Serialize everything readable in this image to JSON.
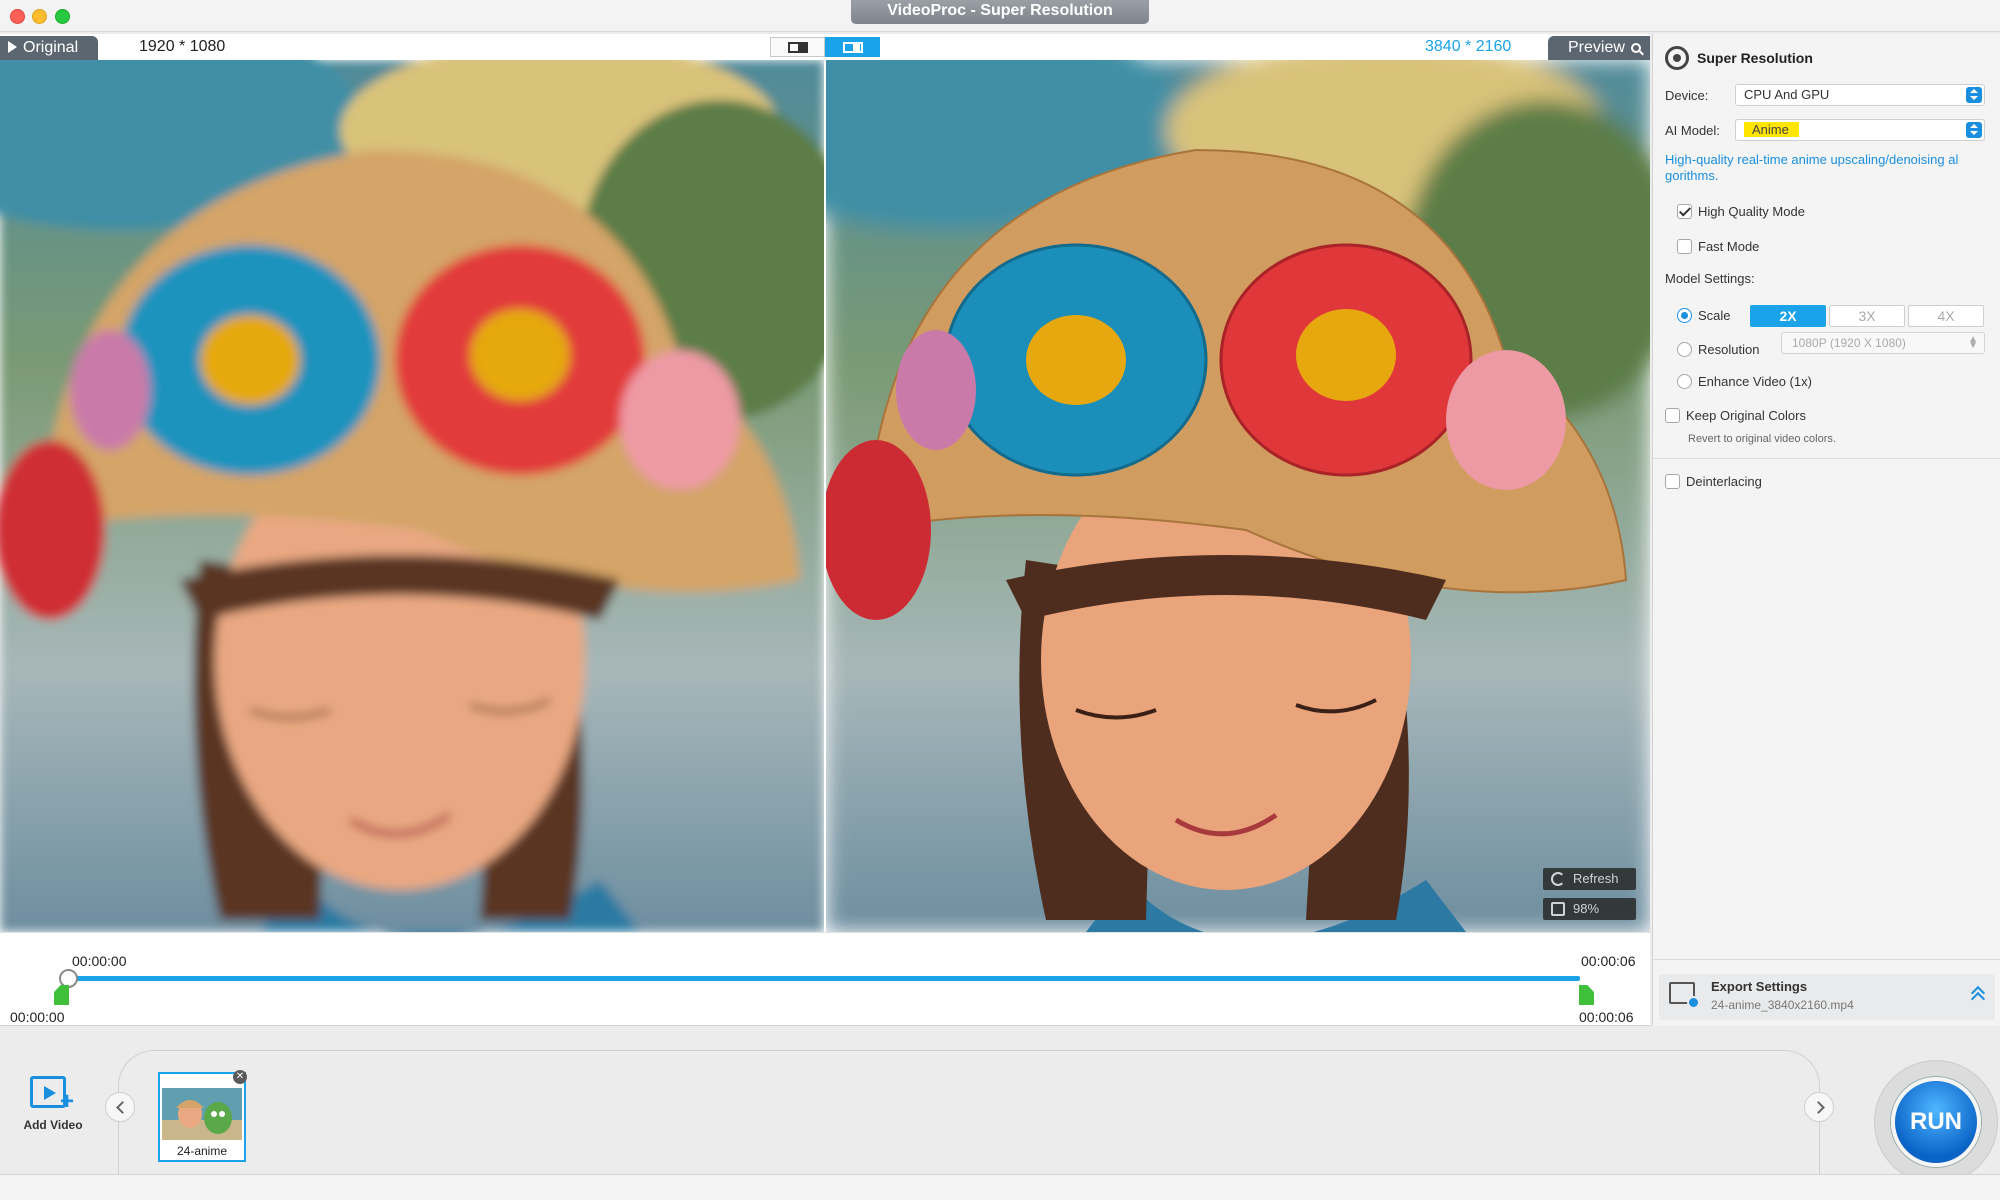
{
  "window": {
    "title": "VideoProc - Super Resolution"
  },
  "preview": {
    "original_tab": "Original",
    "original_resolution": "1920 * 1080",
    "output_resolution": "3840 * 2160",
    "preview_tab": "Preview",
    "refresh_label": "Refresh",
    "zoom_label": "98%"
  },
  "timeline": {
    "current_time": "00:00:00",
    "end_time_top": "00:00:06",
    "start_time": "00:00:00",
    "end_time_bottom": "00:00:06",
    "progress": 0
  },
  "settings": {
    "section_title": "Super Resolution",
    "device_label": "Device:",
    "device_value": "CPU And GPU",
    "ai_model_label": "AI Model:",
    "ai_model_value": "Anime",
    "description": "High-quality real-time anime upscaling/denoising al gorithms.",
    "high_quality_mode": "High Quality Mode",
    "fast_mode": "Fast Mode",
    "model_settings_label": "Model Settings:",
    "scale_label": "Scale",
    "scale_options": [
      "2X",
      "3X",
      "4X"
    ],
    "resolution_label": "Resolution",
    "resolution_value": "1080P (1920 X 1080)",
    "enhance_label": "Enhance Video (1x)",
    "keep_colors_label": "Keep Original Colors",
    "keep_colors_note": "Revert to original video colors.",
    "deinterlacing_label": "Deinterlacing",
    "export_title": "Export Settings",
    "export_file": "24-anime_3840x2160.mp4"
  },
  "bottom": {
    "add_video_label": "Add Video",
    "thumb_label": "24-anime",
    "run_label": "RUN"
  }
}
